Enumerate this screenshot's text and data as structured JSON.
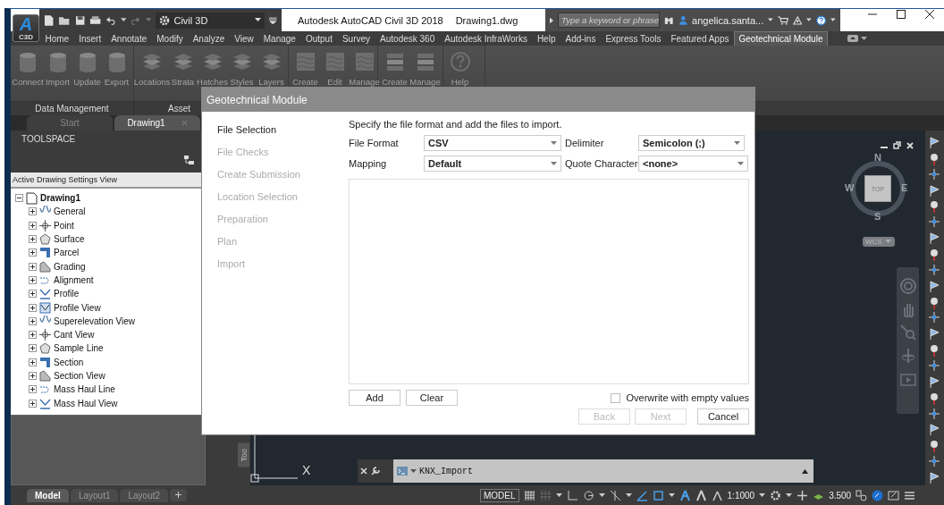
{
  "app_button": {
    "logo_letter": "A",
    "badge": "C3D"
  },
  "quick_access": {
    "workspace": "Civil 3D"
  },
  "window": {
    "title": "Autodesk AutoCAD Civil 3D 2018",
    "document": "Drawing1.dwg"
  },
  "search": {
    "placeholder": "Type a keyword or phrase"
  },
  "user": {
    "name": "angelica.santa..."
  },
  "ribbon_tabs": [
    {
      "label": "Home",
      "selected": false
    },
    {
      "label": "Insert",
      "selected": false
    },
    {
      "label": "Annotate",
      "selected": false
    },
    {
      "label": "Modify",
      "selected": false
    },
    {
      "label": "Analyze",
      "selected": false
    },
    {
      "label": "View",
      "selected": false
    },
    {
      "label": "Manage",
      "selected": false
    },
    {
      "label": "Output",
      "selected": false
    },
    {
      "label": "Survey",
      "selected": false
    },
    {
      "label": "Autodesk 360",
      "selected": false
    },
    {
      "label": "Autodesk InfraWorks",
      "selected": false
    },
    {
      "label": "Help",
      "selected": false
    },
    {
      "label": "Add-ins",
      "selected": false
    },
    {
      "label": "Express Tools",
      "selected": false
    },
    {
      "label": "Featured Apps",
      "selected": false
    },
    {
      "label": "Geotechnical Module",
      "selected": true
    }
  ],
  "ribbon_panels": [
    {
      "title": "Data Management",
      "buttons": [
        {
          "label": "Connect",
          "disabled": true
        },
        {
          "label": "Import",
          "disabled": true
        },
        {
          "label": "Update",
          "disabled": true
        },
        {
          "label": "Export",
          "disabled": true
        }
      ]
    },
    {
      "title": "Asset",
      "buttons": [
        {
          "label": "Locations",
          "disabled": true
        },
        {
          "label": "Strata",
          "disabled": true
        },
        {
          "label": "Hatches",
          "disabled": true
        },
        {
          "label": "Styles",
          "disabled": true
        },
        {
          "label": "Layers",
          "disabled": true
        }
      ]
    },
    {
      "buttons": [
        {
          "label": "Create",
          "disabled": true
        },
        {
          "label": "Edit",
          "disabled": true
        },
        {
          "label": "Manage",
          "disabled": true
        }
      ]
    },
    {
      "buttons": [
        {
          "label": "Create",
          "disabled": true
        },
        {
          "label": "Manage",
          "disabled": true
        }
      ]
    },
    {
      "buttons": [
        {
          "label": "Help",
          "disabled": true
        }
      ]
    }
  ],
  "file_tabs": [
    {
      "label": "Start",
      "selected": false
    },
    {
      "label": "Drawing1",
      "selected": true
    }
  ],
  "toolspace": {
    "title": "TOOLSPACE",
    "view": "Active Drawing Settings View",
    "tree": [
      {
        "label": "Drawing1",
        "expanded": true,
        "children": [
          {
            "label": "General",
            "expanded": false
          },
          {
            "label": "Point",
            "expanded": false
          },
          {
            "label": "Surface",
            "expanded": false
          },
          {
            "label": "Parcel",
            "expanded": false
          },
          {
            "label": "Grading",
            "expanded": false
          },
          {
            "label": "Alignment",
            "expanded": false
          },
          {
            "label": "Profile",
            "expanded": false
          },
          {
            "label": "Profile View",
            "expanded": false
          },
          {
            "label": "Superelevation View",
            "expanded": false
          },
          {
            "label": "Cant View",
            "expanded": false
          },
          {
            "label": "Sample Line",
            "expanded": false
          },
          {
            "label": "Section",
            "expanded": false
          },
          {
            "label": "Section View",
            "expanded": false
          },
          {
            "label": "Mass Haul Line",
            "expanded": false
          },
          {
            "label": "Mass Haul View",
            "expanded": false
          }
        ]
      }
    ],
    "side_tab": "Too"
  },
  "viewport": {
    "compass": {
      "north": "N",
      "east": "E",
      "south": "S",
      "west": "W",
      "cube": "TOP"
    },
    "ucs_menu": "WCS",
    "ucs_axis_label": "X",
    "command": "KNX_Import"
  },
  "dialog": {
    "title": "Geotechnical Module",
    "steps": [
      {
        "label": "File Selection",
        "selected": true
      },
      {
        "label": "File Checks",
        "selected": false
      },
      {
        "label": "Create Submission",
        "selected": false
      },
      {
        "label": "Location Selection",
        "selected": false
      },
      {
        "label": "Preparation",
        "selected": false
      },
      {
        "label": "Plan",
        "selected": false
      },
      {
        "label": "Import",
        "selected": false
      }
    ],
    "instruction": "Specify the file format and add the files to import.",
    "fields": [
      {
        "label": "File Format",
        "value": "CSV"
      },
      {
        "label": "Delimiter",
        "value": "Semicolon (;)"
      },
      {
        "label": "Mapping",
        "value": "Default"
      },
      {
        "label": "Quote Character",
        "value": "<none>"
      }
    ],
    "list_buttons": [
      "Add",
      "Clear"
    ],
    "overwrite": {
      "label": "Overwrite with empty values",
      "checked": false
    },
    "footer_buttons": [
      {
        "label": "Back",
        "disabled": true
      },
      {
        "label": "Next",
        "disabled": true
      },
      {
        "label": "Cancel",
        "disabled": false
      }
    ]
  },
  "layout_tabs": [
    {
      "label": "Model",
      "selected": true
    },
    {
      "label": "Layout1",
      "selected": false
    },
    {
      "label": "Layout2",
      "selected": false
    }
  ],
  "status_bar": {
    "space": "MODEL",
    "scale": "1:1000",
    "annotation_scale": "3.500"
  }
}
